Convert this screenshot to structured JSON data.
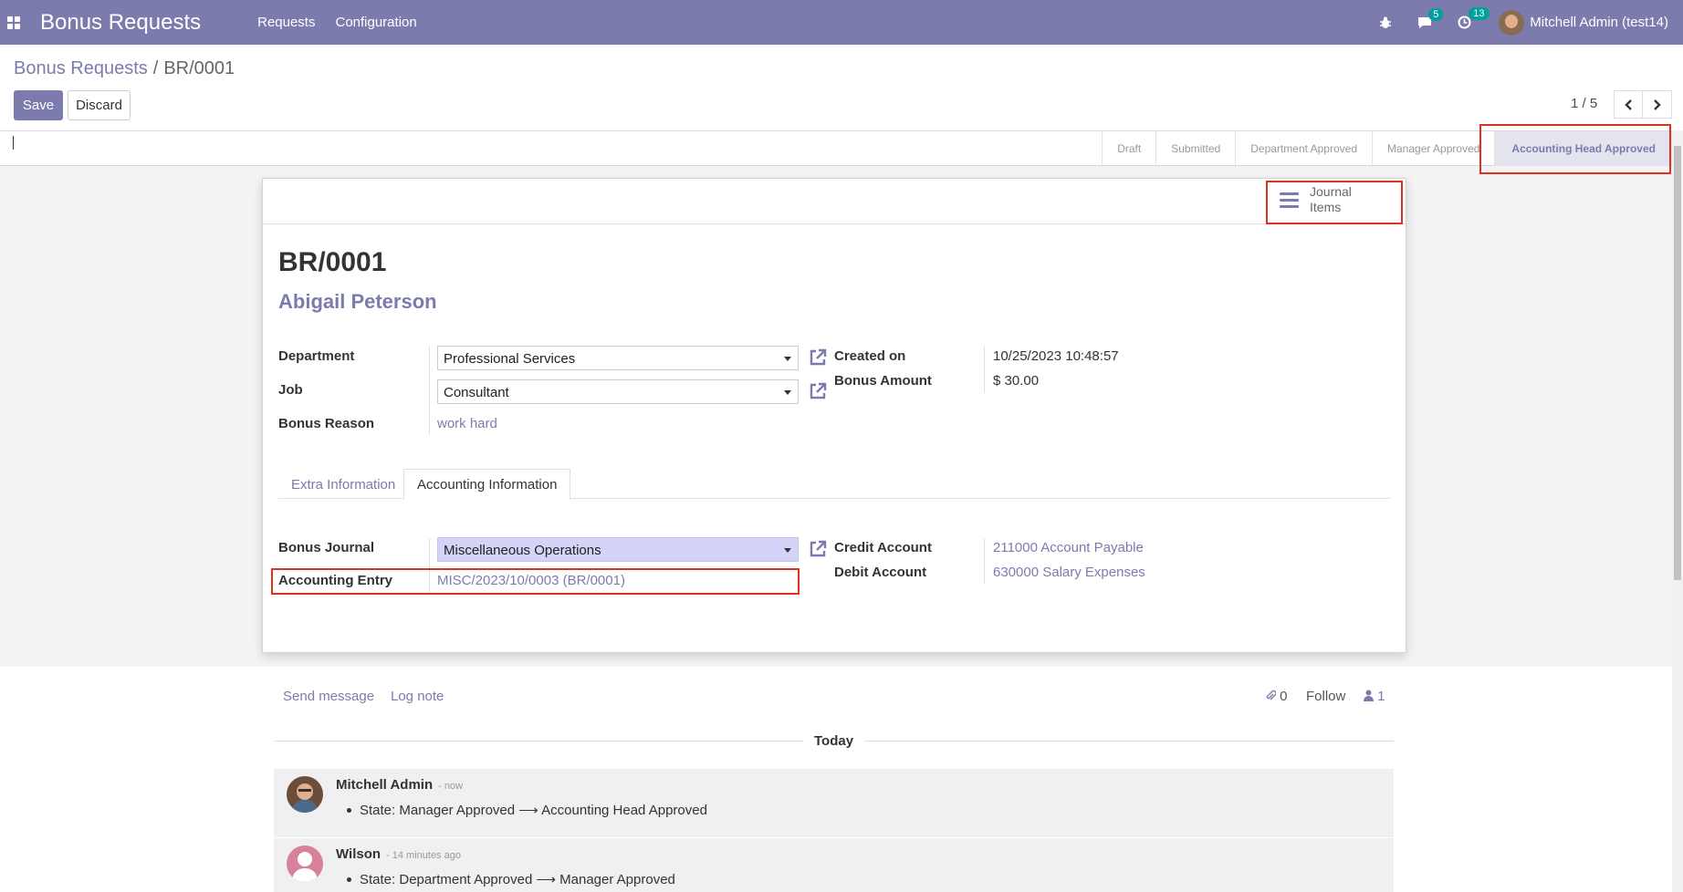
{
  "navbar": {
    "brand": "Bonus Requests",
    "menu": [
      "Requests",
      "Configuration"
    ],
    "messages_count": "5",
    "activities_count": "13",
    "user": "Mitchell Admin (test14)"
  },
  "control": {
    "breadcrumb_parent": "Bonus Requests",
    "breadcrumb_current": "BR/0001",
    "save_label": "Save",
    "discard_label": "Discard",
    "pager": "1 / 5"
  },
  "statusbar": {
    "steps": [
      "Draft",
      "Submitted",
      "Department Approved",
      "Manager Approved",
      "Accounting Head Approved"
    ],
    "active_step": "Accounting Head Approved"
  },
  "smart_button": {
    "label_line1": "Journal",
    "label_line2": "Items"
  },
  "record": {
    "title": "BR/0001",
    "employee": "Abigail Peterson",
    "fields_left": {
      "department_label": "Department",
      "department_value": "Professional Services",
      "job_label": "Job",
      "job_value": "Consultant",
      "reason_label": "Bonus Reason",
      "reason_value": "work hard"
    },
    "fields_right": {
      "created_label": "Created on",
      "created_value": "10/25/2023 10:48:57",
      "amount_label": "Bonus Amount",
      "amount_value": "$ 30.00"
    }
  },
  "tabs": [
    "Extra Information",
    "Accounting Information"
  ],
  "accounting": {
    "journal_label": "Bonus Journal",
    "journal_value": "Miscellaneous Operations",
    "entry_label": "Accounting Entry",
    "entry_value": "MISC/2023/10/0003 (BR/0001)",
    "credit_label": "Credit Account",
    "credit_value": "211000 Account Payable",
    "debit_label": "Debit Account",
    "debit_value": "630000 Salary Expenses"
  },
  "chatter": {
    "send_message": "Send message",
    "log_note": "Log note",
    "attachments": "0",
    "follow": "Follow",
    "followers": "1",
    "today": "Today",
    "messages": [
      {
        "author": "Mitchell Admin",
        "date": "- now",
        "from_state": "State: Manager Approved",
        "to_state": "Accounting Head Approved"
      },
      {
        "author": "Wilson",
        "date": "- 14 minutes ago",
        "from_state": "State: Department Approved",
        "to_state": "Manager Approved"
      }
    ]
  },
  "colors": {
    "brand": "#7c7bad",
    "highlight": "#e0301e"
  }
}
